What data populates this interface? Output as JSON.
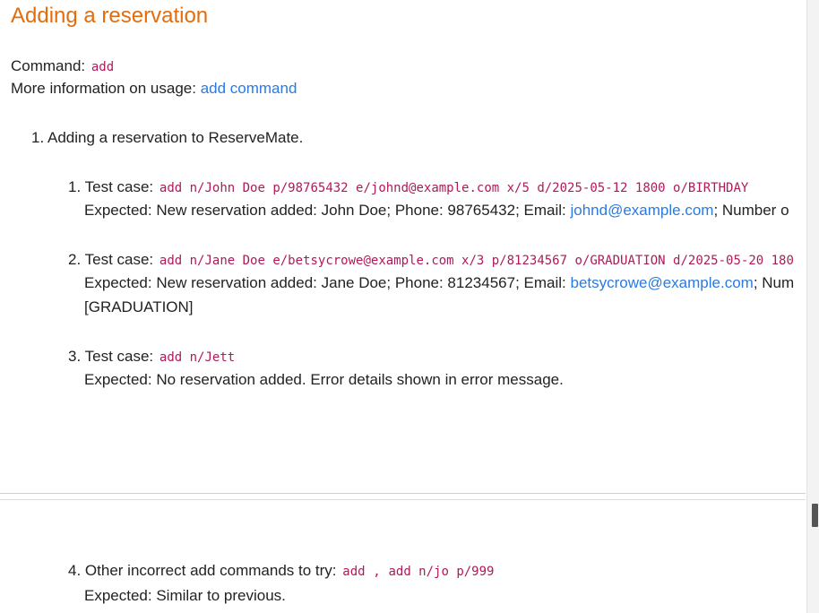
{
  "heading": "Adding a reservation",
  "command_line": {
    "label": "Command:",
    "code": "add"
  },
  "usage_line": {
    "label": "More information on usage:",
    "link": "add command"
  },
  "section": {
    "number": "1.",
    "text": "Adding a reservation to ReserveMate."
  },
  "test_cases": [
    {
      "number": "1.",
      "label": "Test case:",
      "code": "add n/John Doe p/98765432 e/johnd@example.com x/5 d/2025-05-12 1800 o/BIRTHDAY",
      "expected_label": "Expected:",
      "expected_pre": "New reservation added: John Doe; Phone: 98765432; Email:",
      "expected_link": "johnd@example.com",
      "expected_post": "; Number o"
    },
    {
      "number": "2.",
      "label": "Test case:",
      "code": "add n/Jane Doe e/betsycrowe@example.com x/3 p/81234567 o/GRADUATION d/2025-05-20 180",
      "expected_label": "Expected:",
      "expected_pre": "New reservation added: Jane Doe; Phone: 81234567; Email:",
      "expected_link": "betsycrowe@example.com",
      "expected_post": "; Num",
      "expected_cont": "[GRADUATION]"
    },
    {
      "number": "3.",
      "label": "Test case:",
      "code": "add n/Jett",
      "expected_label": "Expected:",
      "expected_text": "No reservation added. Error details shown in error message."
    }
  ],
  "other": {
    "number": "4.",
    "label": "Other incorrect add commands to try:",
    "code_a": "add",
    "separator": ",",
    "code_b": "add n/jo p/999",
    "expected_label": "Expected:",
    "expected_text": "Similar to previous."
  }
}
